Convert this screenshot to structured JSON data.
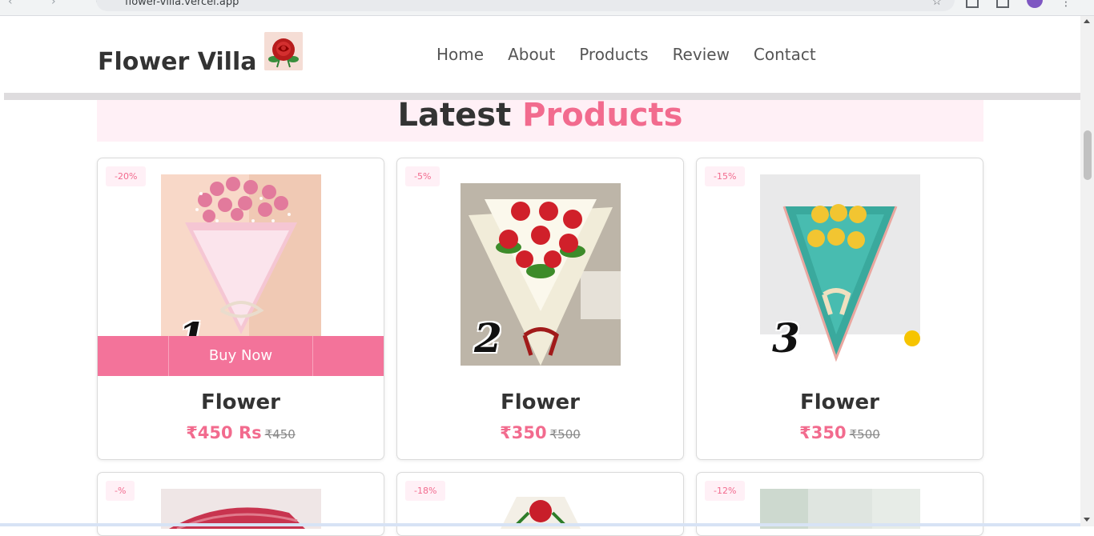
{
  "browser": {
    "url": "flower-villa.vercel.app"
  },
  "brand": {
    "name": "Flower Villa"
  },
  "nav": {
    "items": [
      "Home",
      "About",
      "Products",
      "Review",
      "Contact"
    ]
  },
  "section": {
    "title_main": "Latest",
    "title_accent": "Products"
  },
  "products": [
    {
      "discount": "-20%",
      "name": "Flower",
      "price": "₹450 Rs",
      "old_price": "₹450",
      "buy_label": "Buy Now",
      "badge": "1"
    },
    {
      "discount": "-5%",
      "name": "Flower",
      "price": "₹350",
      "old_price": "₹500",
      "badge": "2"
    },
    {
      "discount": "-15%",
      "name": "Flower",
      "price": "₹350",
      "old_price": "₹500",
      "badge": "3"
    },
    {
      "discount": "-%"
    },
    {
      "discount": "-18%"
    },
    {
      "discount": "-12%"
    }
  ],
  "colors": {
    "accent": "#f26b8e",
    "buy_bar": "#f3739a",
    "heading_band": "#fff0f6"
  }
}
